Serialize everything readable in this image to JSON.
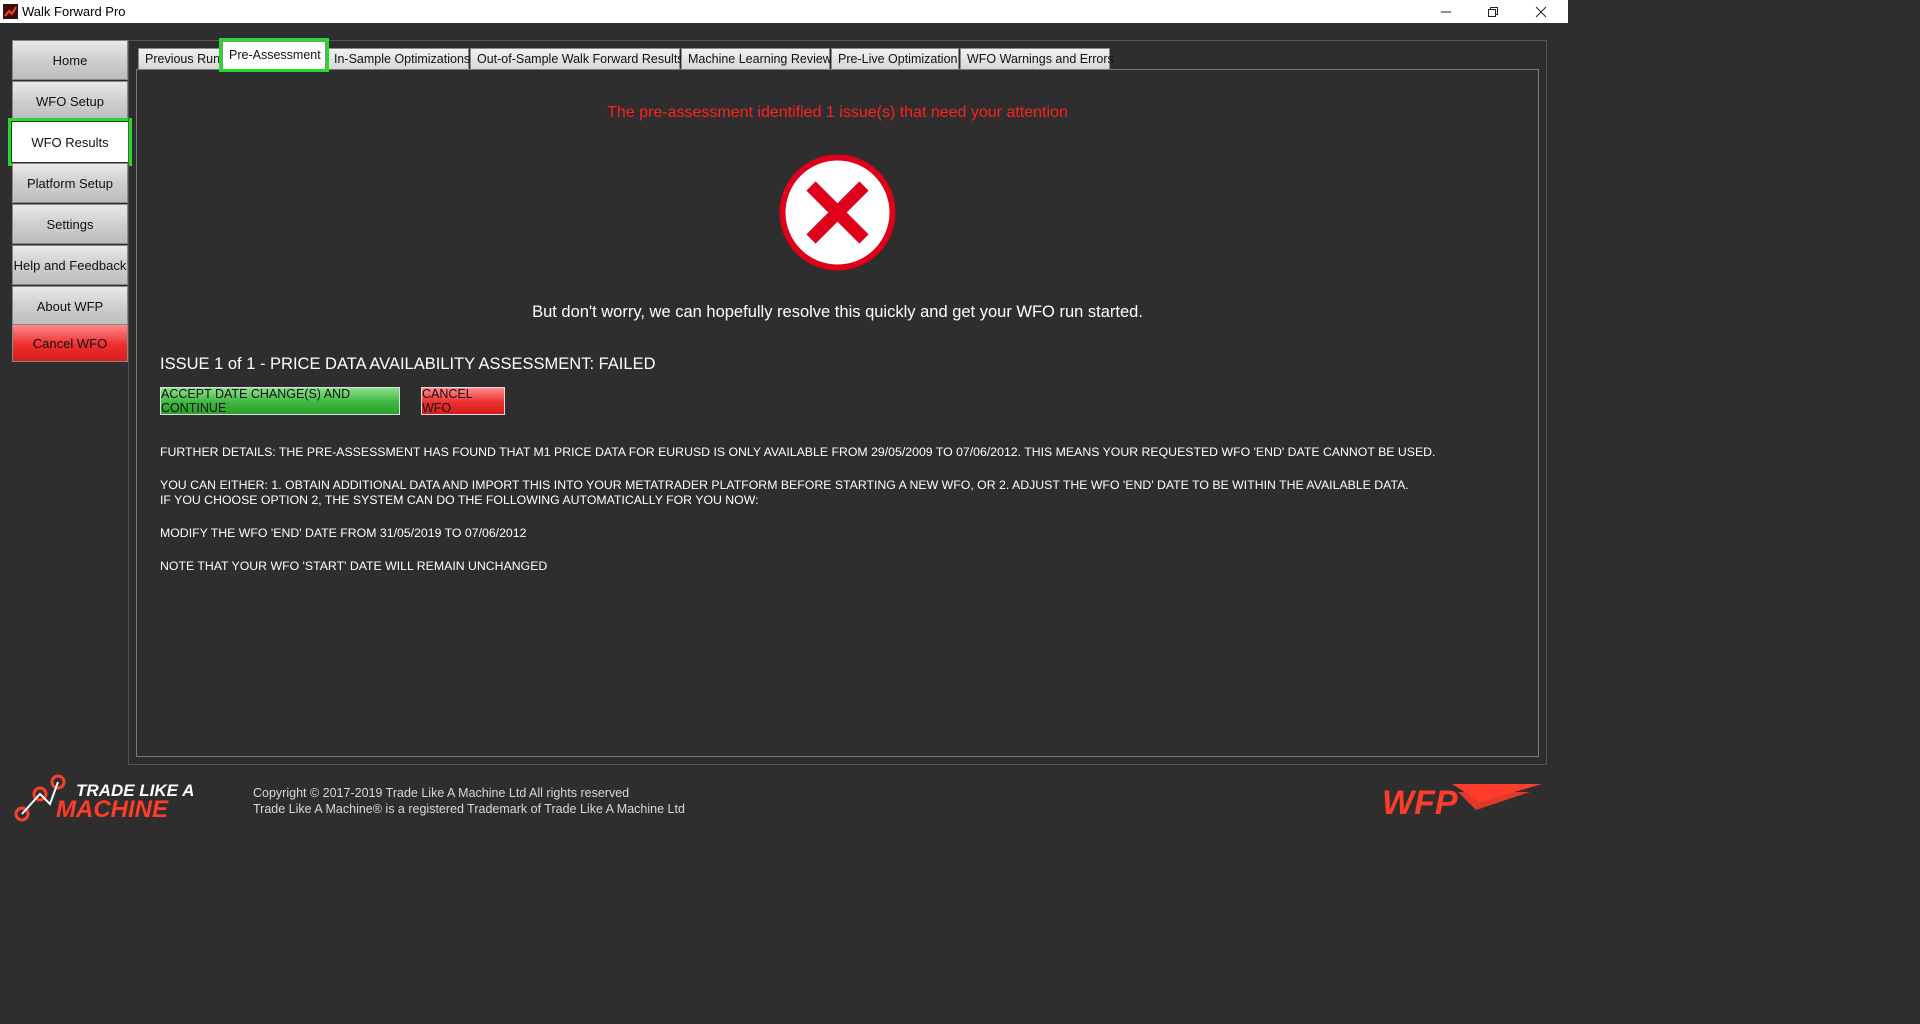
{
  "window": {
    "title": "Walk Forward Pro"
  },
  "sidebar": {
    "items": [
      {
        "label": "Home"
      },
      {
        "label": "WFO Setup"
      },
      {
        "label": "WFO Results"
      },
      {
        "label": "Platform Setup"
      },
      {
        "label": "Settings"
      },
      {
        "label": "Help and Feedback"
      },
      {
        "label": "About WFP"
      },
      {
        "label": "Cancel WFO"
      }
    ]
  },
  "tabs": [
    {
      "label": "Previous Runs"
    },
    {
      "label": "Pre-Assessment"
    },
    {
      "label": "In-Sample Optimizations"
    },
    {
      "label": "Out-of-Sample Walk Forward Results"
    },
    {
      "label": "Machine Learning Review"
    },
    {
      "label": "Pre-Live Optimization"
    },
    {
      "label": "WFO Warnings and Errors"
    }
  ],
  "assessment": {
    "headline": "The pre-assessment identified 1 issue(s) that need your attention",
    "reassurance": "But don't worry, we can hopefully resolve this quickly and get your WFO run started.",
    "issue_title": "ISSUE 1 of 1 - PRICE DATA AVAILABILITY ASSESSMENT: FAILED",
    "accept_label": "ACCEPT DATE CHANGE(S) AND CONTINUE",
    "cancel_label": "CANCEL WFO",
    "further_details": "FURTHER DETAILS: THE PRE-ASSESSMENT HAS FOUND THAT M1 PRICE DATA FOR EURUSD IS ONLY AVAILABLE FROM 29/05/2009 TO 07/06/2012. THIS MEANS YOUR REQUESTED WFO 'END' DATE CANNOT BE USED.",
    "options_line1": "YOU CAN EITHER: 1. OBTAIN ADDITIONAL DATA AND IMPORT THIS INTO YOUR METATRADER PLATFORM BEFORE STARTING A NEW WFO, OR 2. ADJUST THE WFO 'END' DATE TO BE WITHIN THE AVAILABLE DATA.",
    "options_line2": "IF YOU CHOOSE OPTION 2, THE SYSTEM CAN DO THE FOLLOWING AUTOMATICALLY FOR YOU NOW:",
    "modify_line": "MODIFY THE WFO 'END' DATE FROM 31/05/2019 TO 07/06/2012",
    "note_line": "NOTE THAT YOUR WFO 'START' DATE WILL REMAIN UNCHANGED"
  },
  "footer": {
    "logo_line1": "TRADE LIKE A",
    "logo_line2": "MACHINE",
    "copyright": "Copyright © 2017-2019 Trade Like A Machine Ltd All rights reserved",
    "trademark": "Trade Like A Machine® is a registered Trademark of Trade Like A Machine Ltd",
    "brand_logo": "WFP"
  },
  "colors": {
    "error_red": "#ff2020",
    "highlight_green": "#22dd22",
    "background": "#2e2e2e"
  }
}
